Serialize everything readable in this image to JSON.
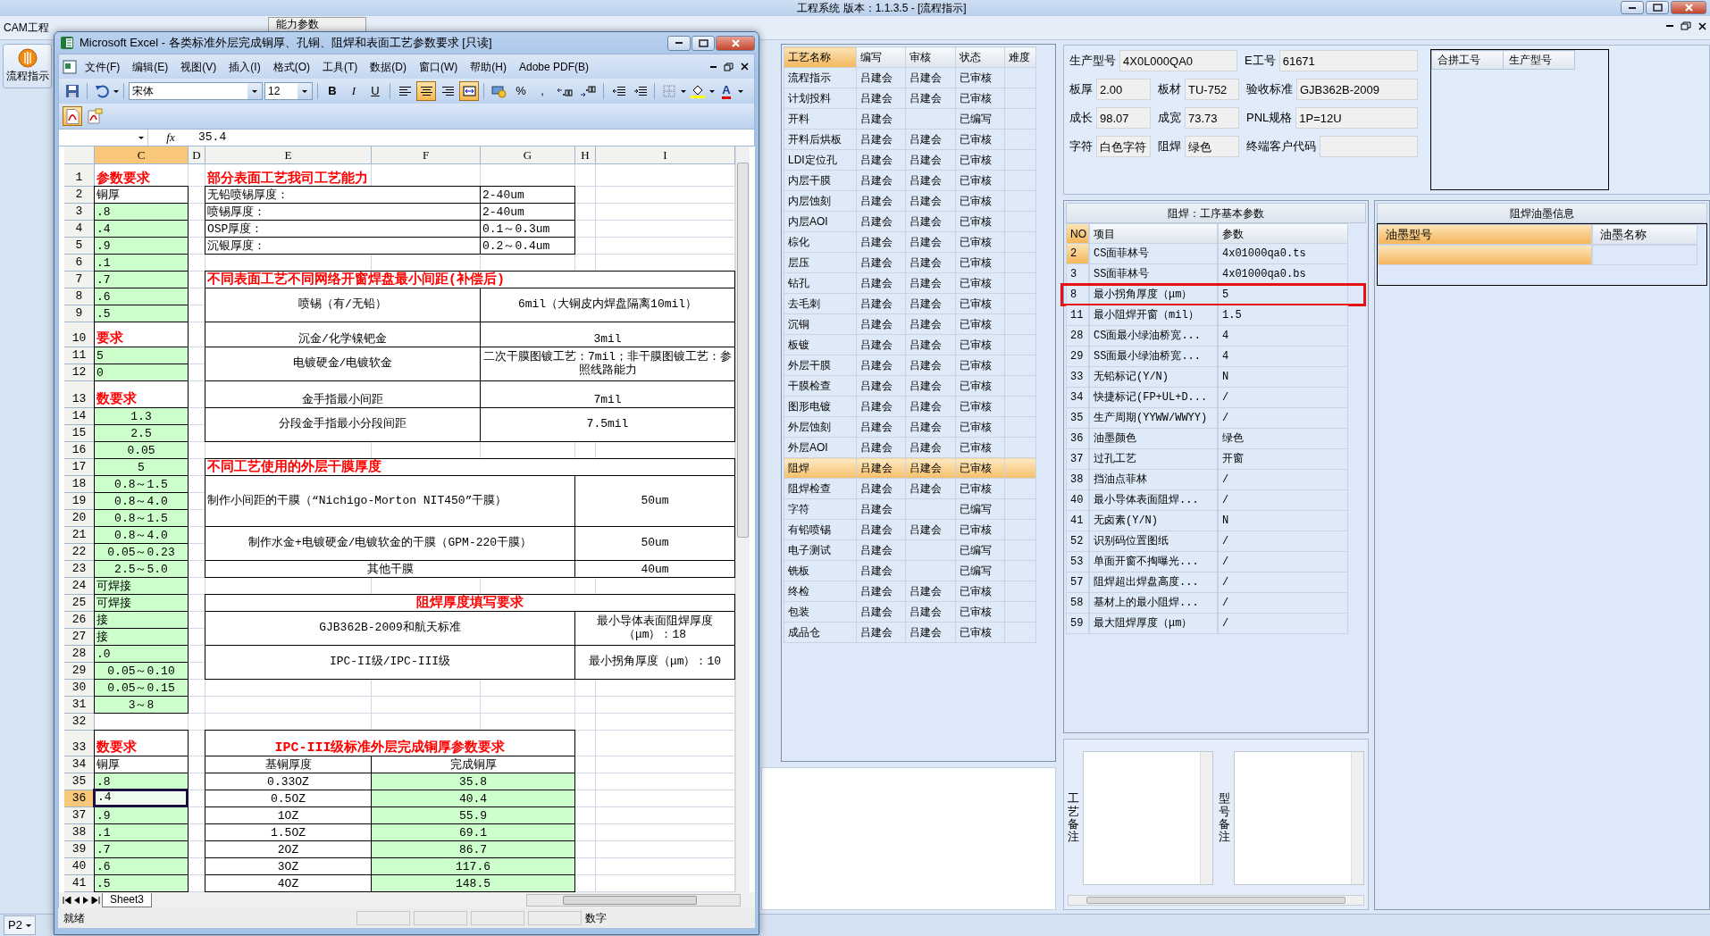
{
  "app": {
    "title": "工程系统  版本：1.1.3.5 - [流程指示]",
    "menu": [
      "CAM工程"
    ],
    "open_tab": "能力参数",
    "sidebar": [
      {
        "label": "流程指示"
      }
    ],
    "status": "P2"
  },
  "excel": {
    "title": "Microsoft Excel - 各类标准外层完成铜厚、孔铜、阻焊和表面工艺参数要求  [只读]",
    "menu": [
      "文件(F)",
      "编辑(E)",
      "视图(V)",
      "插入(I)",
      "格式(O)",
      "工具(T)",
      "数据(D)",
      "窗口(W)",
      "帮助(H)",
      "Adobe PDF(B)"
    ],
    "toolbar": {
      "font": "宋体",
      "size": "12",
      "styles": [
        "B",
        "I",
        "U"
      ],
      "alignment": [
        {
          "selected": false
        },
        {
          "selected": true
        },
        {
          "selected": false
        },
        {
          "selected": true
        }
      ],
      "number": [
        "%",
        ","
      ],
      "font_color": "A"
    },
    "formula": {
      "fx": "fx",
      "value": "35.4"
    },
    "columns": [
      "C",
      "D",
      "E",
      "F",
      "G",
      "H",
      "I"
    ],
    "rows": [
      "1",
      "2",
      "3",
      "4",
      "5",
      "6",
      "7",
      "8",
      "9",
      "10",
      "11",
      "12",
      "13",
      "14",
      "15",
      "16",
      "17",
      "18",
      "19",
      "20",
      "21",
      "22",
      "23",
      "24",
      "25",
      "26",
      "27",
      "28",
      "29",
      "30",
      "31",
      "32",
      "33",
      "34",
      "35",
      "36",
      "37",
      "38",
      "39",
      "40",
      "41"
    ],
    "cells": [
      {
        "text": "参数要求",
        "kind": "title",
        "selected": false
      },
      {
        "text": "铜厚",
        "kind": "text",
        "selected": false
      },
      {
        "text": ".8",
        "kind": "value",
        "selected": false
      },
      {
        "text": ".4",
        "kind": "value",
        "selected": false
      },
      {
        "text": ".9",
        "kind": "value",
        "selected": false
      },
      {
        "text": ".1",
        "kind": "value",
        "selected": false
      },
      {
        "text": ".7",
        "kind": "value",
        "selected": false
      },
      {
        "text": ".6",
        "kind": "value",
        "selected": false
      },
      {
        "text": ".5",
        "kind": "value",
        "selected": false
      },
      {
        "text": "要求",
        "kind": "heading",
        "selected": false
      },
      {
        "text": "5",
        "kind": "value",
        "selected": false
      },
      {
        "text": "0",
        "kind": "value",
        "selected": false
      },
      {
        "text": "数要求",
        "kind": "heading",
        "selected": false
      },
      {
        "text": "1.3",
        "kind": "value",
        "selected": false
      },
      {
        "text": "2.5",
        "kind": "value",
        "selected": false
      },
      {
        "text": "0.05",
        "kind": "value",
        "selected": false
      },
      {
        "text": "5",
        "kind": "value",
        "selected": false
      },
      {
        "text": "0.8～1.5",
        "kind": "value",
        "selected": false
      },
      {
        "text": "0.8～4.0",
        "kind": "value",
        "selected": false
      },
      {
        "text": "0.8～1.5",
        "kind": "value",
        "selected": false
      },
      {
        "text": "0.8～4.0",
        "kind": "value",
        "selected": false
      },
      {
        "text": "0.05～0.23",
        "kind": "value",
        "selected": false
      },
      {
        "text": "2.5～5.0",
        "kind": "value",
        "selected": false
      },
      {
        "text": "可焊接",
        "kind": "value",
        "selected": false
      },
      {
        "text": "可焊接",
        "kind": "value",
        "selected": false
      },
      {
        "text": "接",
        "kind": "value",
        "selected": false
      },
      {
        "text": "接",
        "kind": "value",
        "selected": false
      },
      {
        "text": ".0",
        "kind": "value",
        "selected": false
      },
      {
        "text": "0.05～0.10",
        "kind": "value",
        "selected": false
      },
      {
        "text": "0.05～0.15",
        "kind": "value",
        "selected": false
      },
      {
        "text": "3～8",
        "kind": "value",
        "selected": false
      },
      {
        "text": "数要求",
        "kind": "heading",
        "selected": false
      },
      {
        "text": "铜厚",
        "kind": "text",
        "selected": false
      },
      {
        "text": ".8",
        "kind": "value",
        "selected": false
      },
      {
        "text": ".4",
        "kind": "value",
        "selected": true
      },
      {
        "text": ".9",
        "kind": "value",
        "selected": false
      },
      {
        "text": ".1",
        "kind": "value",
        "selected": false
      },
      {
        "text": ".7",
        "kind": "value",
        "selected": false
      },
      {
        "text": ".6",
        "kind": "value",
        "selected": false
      },
      {
        "text": ".5",
        "kind": "value",
        "selected": false
      },
      {
        "text": "部分表面工艺我司工艺能力",
        "kind": "title",
        "selected": false
      },
      {
        "text": "无铅喷锡厚度：",
        "kind": "text",
        "selected": false
      },
      {
        "text": "2-40um",
        "kind": "text",
        "selected": false
      },
      {
        "text": "喷锡厚度：",
        "kind": "text",
        "selected": false
      },
      {
        "text": "2-40um",
        "kind": "text",
        "selected": false
      },
      {
        "text": "OSP厚度：",
        "kind": "text",
        "selected": false
      },
      {
        "text": "0.1～0.3um",
        "kind": "text",
        "selected": false
      },
      {
        "text": "沉银厚度：",
        "kind": "text",
        "selected": false
      },
      {
        "text": "0.2～0.4um",
        "kind": "text",
        "selected": false
      },
      {
        "text": "不同表面工艺不同网络开窗焊盘最小间距(补偿后)",
        "kind": "heading",
        "selected": false
      },
      {
        "text": "喷锡（有/无铅）",
        "kind": "text",
        "selected": false
      },
      {
        "text": "6mil（大铜皮内焊盘隔离10mil）",
        "kind": "text",
        "selected": false
      },
      {
        "text": "沉金/化学镍钯金",
        "kind": "text",
        "selected": false
      },
      {
        "text": "3mil",
        "kind": "text",
        "selected": false
      },
      {
        "text": "电镀硬金/电镀软金",
        "kind": "text",
        "selected": false
      },
      {
        "text": "二次干膜图镀工艺：7mil；非干膜图镀工艺：参照线路能力",
        "kind": "text",
        "selected": false
      },
      {
        "text": "金手指最小间距",
        "kind": "text",
        "selected": false
      },
      {
        "text": "7mil",
        "kind": "text",
        "selected": false
      },
      {
        "text": "分段金手指最小分段间距",
        "kind": "text",
        "selected": false
      },
      {
        "text": "7.5mil",
        "kind": "text",
        "selected": false
      },
      {
        "text": "不同工艺使用的外层干膜厚度",
        "kind": "heading",
        "selected": false
      },
      {
        "text": "制作小间距的干膜（“Nichigo-Morton NIT450”干膜）",
        "kind": "text",
        "selected": false
      },
      {
        "text": "50um",
        "kind": "text",
        "selected": false
      },
      {
        "text": "制作水金+电镀硬金/电镀软金的干膜（GPM-220干膜）",
        "kind": "text",
        "selected": false
      },
      {
        "text": "50um",
        "kind": "text",
        "selected": false
      },
      {
        "text": "其他干膜",
        "kind": "text",
        "selected": false
      },
      {
        "text": "40um",
        "kind": "text",
        "selected": false
      },
      {
        "text": "阻焊厚度填写要求",
        "kind": "heading",
        "selected": false
      },
      {
        "text": "GJB362B-2009和航天标准",
        "kind": "text",
        "selected": false
      },
      {
        "text": "最小导体表面阻焊厚度（μm）：18",
        "kind": "text",
        "selected": false
      },
      {
        "text": "IPC-II级/IPC-III级",
        "kind": "text",
        "selected": false
      },
      {
        "text": "最小拐角厚度（μm）：10",
        "kind": "text",
        "selected": false
      },
      {
        "text": "IPC-III级标准外层完成铜厚参数要求",
        "kind": "heading",
        "selected": false
      },
      {
        "text": "基铜厚度",
        "kind": "text",
        "selected": false
      },
      {
        "text": "完成铜厚",
        "kind": "text",
        "selected": false
      },
      {
        "text": "0.33OZ",
        "kind": "text",
        "selected": false
      },
      {
        "text": "35.8",
        "kind": "value",
        "selected": false
      },
      {
        "text": "0.5OZ",
        "kind": "text",
        "selected": false
      },
      {
        "text": "40.4",
        "kind": "value",
        "selected": false
      },
      {
        "text": "1OZ",
        "kind": "text",
        "selected": false
      },
      {
        "text": "55.9",
        "kind": "value",
        "selected": false
      },
      {
        "text": "1.5OZ",
        "kind": "text",
        "selected": false
      },
      {
        "text": "69.1",
        "kind": "value",
        "selected": false
      },
      {
        "text": "2OZ",
        "kind": "text",
        "selected": false
      },
      {
        "text": "86.7",
        "kind": "value",
        "selected": false
      },
      {
        "text": "3OZ",
        "kind": "text",
        "selected": false
      },
      {
        "text": "117.6",
        "kind": "value",
        "selected": false
      },
      {
        "text": "4OZ",
        "kind": "text",
        "selected": false
      },
      {
        "text": "148.5",
        "kind": "value",
        "selected": false
      }
    ],
    "sheets": [
      {
        "name": "Sheet3",
        "selected": true
      }
    ],
    "status": [
      "就绪",
      "数字"
    ]
  },
  "process_table": {
    "columns": [
      {
        "label": "工艺名称",
        "selected": true
      },
      {
        "label": "编写",
        "selected": false
      },
      {
        "label": "审核",
        "selected": false
      },
      {
        "label": "状态",
        "selected": false
      },
      {
        "label": "难度",
        "selected": false
      }
    ],
    "rows": [
      {
        "name": "流程指示",
        "writer": "吕建会",
        "reviewer": "吕建会",
        "status": "已审核",
        "selected": false
      },
      {
        "name": "计划投料",
        "writer": "吕建会",
        "reviewer": "吕建会",
        "status": "已审核",
        "selected": false
      },
      {
        "name": "开料",
        "writer": "吕建会",
        "status": "已编写",
        "selected": false
      },
      {
        "name": "开料后烘板",
        "writer": "吕建会",
        "reviewer": "吕建会",
        "status": "已审核",
        "selected": false
      },
      {
        "name": "LDI定位孔",
        "writer": "吕建会",
        "reviewer": "吕建会",
        "status": "已审核",
        "selected": false
      },
      {
        "name": "内层干膜",
        "writer": "吕建会",
        "reviewer": "吕建会",
        "status": "已审核",
        "selected": false
      },
      {
        "name": "内层蚀刻",
        "writer": "吕建会",
        "reviewer": "吕建会",
        "status": "已审核",
        "selected": false
      },
      {
        "name": "内层AOI",
        "writer": "吕建会",
        "reviewer": "吕建会",
        "status": "已审核",
        "selected": false
      },
      {
        "name": "棕化",
        "writer": "吕建会",
        "reviewer": "吕建会",
        "status": "已审核",
        "selected": false
      },
      {
        "name": "层压",
        "writer": "吕建会",
        "reviewer": "吕建会",
        "status": "已审核",
        "selected": false
      },
      {
        "name": "钻孔",
        "writer": "吕建会",
        "reviewer": "吕建会",
        "status": "已审核",
        "selected": false
      },
      {
        "name": "去毛刺",
        "writer": "吕建会",
        "reviewer": "吕建会",
        "status": "已审核",
        "selected": false
      },
      {
        "name": "沉铜",
        "writer": "吕建会",
        "reviewer": "吕建会",
        "status": "已审核",
        "selected": false
      },
      {
        "name": "板镀",
        "writer": "吕建会",
        "reviewer": "吕建会",
        "status": "已审核",
        "selected": false
      },
      {
        "name": "外层干膜",
        "writer": "吕建会",
        "reviewer": "吕建会",
        "status": "已审核",
        "selected": false
      },
      {
        "name": "干膜检查",
        "writer": "吕建会",
        "reviewer": "吕建会",
        "status": "已审核",
        "selected": false
      },
      {
        "name": "图形电镀",
        "writer": "吕建会",
        "reviewer": "吕建会",
        "status": "已审核",
        "selected": false
      },
      {
        "name": "外层蚀刻",
        "writer": "吕建会",
        "reviewer": "吕建会",
        "status": "已审核",
        "selected": false
      },
      {
        "name": "外层AOI",
        "writer": "吕建会",
        "reviewer": "吕建会",
        "status": "已审核",
        "selected": false
      },
      {
        "name": "阻焊",
        "writer": "吕建会",
        "reviewer": "吕建会",
        "status": "已审核",
        "selected": true
      },
      {
        "name": "阻焊检查",
        "writer": "吕建会",
        "reviewer": "吕建会",
        "status": "已审核",
        "selected": false
      },
      {
        "name": "字符",
        "writer": "吕建会",
        "status": "已编写",
        "selected": false
      },
      {
        "name": "有铅喷锡",
        "writer": "吕建会",
        "reviewer": "吕建会",
        "status": "已审核",
        "selected": false
      },
      {
        "name": "电子测试",
        "writer": "吕建会",
        "status": "已编写",
        "selected": false
      },
      {
        "name": "铣板",
        "writer": "吕建会",
        "status": "已编写",
        "selected": false
      },
      {
        "name": "终检",
        "writer": "吕建会",
        "reviewer": "吕建会",
        "status": "已审核",
        "selected": false
      },
      {
        "name": "包装",
        "writer": "吕建会",
        "reviewer": "吕建会",
        "status": "已审核",
        "selected": false
      },
      {
        "name": "成品仓",
        "writer": "吕建会",
        "reviewer": "吕建会",
        "status": "已审核",
        "selected": false
      }
    ]
  },
  "job_info": {
    "fields": [
      {
        "label": "生产型号",
        "value": "4X0L000QA0"
      },
      {
        "label": "E工号",
        "value": "61671"
      },
      {
        "label": "板厚",
        "value": "2.00"
      },
      {
        "label": "板材",
        "value": "TU-752"
      },
      {
        "label": "验收标准",
        "value": "GJB362B-2009"
      },
      {
        "label": "成长",
        "value": "98.07"
      },
      {
        "label": "成宽",
        "value": "73.73"
      },
      {
        "label": "PNL规格",
        "value": "1P=12U"
      },
      {
        "label": "字符",
        "value": "白色字符"
      },
      {
        "label": "阻焊",
        "value": "绿色"
      },
      {
        "label": "终端客户代码"
      }
    ]
  },
  "merge_list": {
    "columns": [
      "合拼工号",
      "生产型号"
    ]
  },
  "params_panel": {
    "title": "阻焊：工序基本参数",
    "columns": [
      "NO",
      "项目",
      "参数"
    ],
    "rows": [
      {
        "no": "2",
        "item": "CS面菲林号",
        "value": "4x01000qa0.ts",
        "selected": true,
        "highlighted": false
      },
      {
        "no": "3",
        "item": "SS面菲林号",
        "value": "4x01000qa0.bs",
        "selected": false,
        "highlighted": false
      },
      {
        "no": "8",
        "item": "最小拐角厚度（μm）",
        "value": "5",
        "selected": false,
        "highlighted": true
      },
      {
        "no": "11",
        "item": "最小阻焊开窗（mil）",
        "value": "1.5",
        "selected": false,
        "highlighted": false
      },
      {
        "no": "28",
        "item": "CS面最小绿油桥宽...",
        "value": "4",
        "selected": false,
        "highlighted": false
      },
      {
        "no": "29",
        "item": "SS面最小绿油桥宽...",
        "value": "4",
        "selected": false,
        "highlighted": false
      },
      {
        "no": "33",
        "item": "无铅标记(Y/N)",
        "value": "N",
        "selected": false,
        "highlighted": false
      },
      {
        "no": "34",
        "item": "快捷标记(FP+UL+D...",
        "value": "/",
        "selected": false,
        "highlighted": false
      },
      {
        "no": "35",
        "item": "生产周期(YYWW/WWYY)",
        "value": "/",
        "selected": false,
        "highlighted": false
      },
      {
        "no": "36",
        "item": "油墨颜色",
        "value": "绿色",
        "selected": false,
        "highlighted": false
      },
      {
        "no": "37",
        "item": "过孔工艺",
        "value": "开窗",
        "selected": false,
        "highlighted": false
      },
      {
        "no": "38",
        "item": "挡油点菲林",
        "value": "/",
        "selected": false,
        "highlighted": false
      },
      {
        "no": "40",
        "item": "最小导体表面阻焊...",
        "value": "/",
        "selected": false,
        "highlighted": false
      },
      {
        "no": "41",
        "item": "无卤素(Y/N)",
        "value": "N",
        "selected": false,
        "highlighted": false
      },
      {
        "no": "52",
        "item": "识别码位置图纸",
        "value": "/",
        "selected": false,
        "highlighted": false
      },
      {
        "no": "53",
        "item": "单面开窗不掏曝光...",
        "value": "/",
        "selected": false,
        "highlighted": false
      },
      {
        "no": "57",
        "item": "阻焊超出焊盘高度...",
        "value": "/",
        "selected": false,
        "highlighted": false
      },
      {
        "no": "58",
        "item": "基材上的最小阻焊...",
        "value": "/",
        "selected": false,
        "highlighted": false
      },
      {
        "no": "59",
        "item": "最大阻焊厚度（μm）",
        "value": "/",
        "selected": false,
        "highlighted": false
      }
    ]
  },
  "ink_panel": {
    "title": "阻焊油墨信息",
    "columns": [
      "油墨型号",
      "油墨名称"
    ],
    "rows": [
      {
        "selected": true
      }
    ]
  },
  "remarks": [
    {
      "label": "工艺备注"
    },
    {
      "label": "型号备注"
    }
  ]
}
